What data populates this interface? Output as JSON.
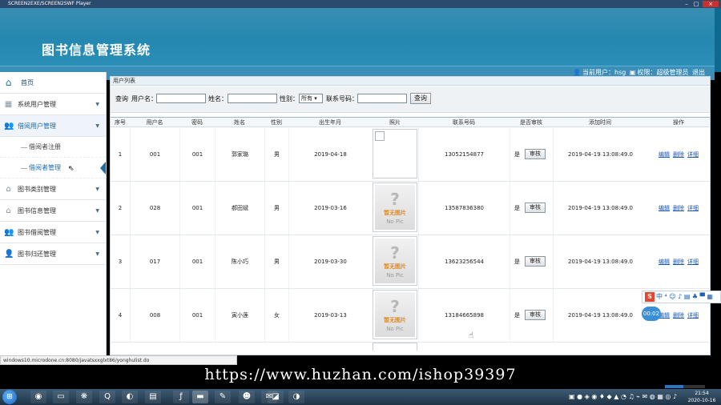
{
  "window": {
    "title": "SCREEN2EXE/SCREEN2SWF Player"
  },
  "header": {
    "system_title": "图书信息管理系统",
    "user_label": "当前用户：hsg",
    "role_label": "权限：超级管理员",
    "logout": "退出"
  },
  "sidebar": {
    "home": "首页",
    "items": [
      {
        "label": "系统用户管理"
      },
      {
        "label": "借阅用户管理"
      },
      {
        "label": "图书类别管理"
      },
      {
        "label": "图书信息管理"
      },
      {
        "label": "图书借阅管理"
      },
      {
        "label": "图书归还管理"
      }
    ],
    "subitems": [
      {
        "label": "借阅者注册"
      },
      {
        "label": "借阅者管理"
      }
    ]
  },
  "panel": {
    "title": "用户列表"
  },
  "search": {
    "prefix": "查询",
    "username_label": "用户名：",
    "name_label": "姓名：",
    "gender_label": "性别：",
    "gender_selected": "所有",
    "phone_label": "联系号码：",
    "query_button": "查询"
  },
  "table": {
    "headers": [
      "序号",
      "用户名",
      "密码",
      "姓名",
      "性别",
      "出生年月",
      "照片",
      "联系号码",
      "是否审核",
      "添加时间",
      "操作"
    ],
    "rows": [
      {
        "no": "1",
        "username": "001",
        "password": "001",
        "name": "郭家璐",
        "gender": "男",
        "birth": "2019-04-18",
        "photo": "broken",
        "phone": "13052154877",
        "audited": "是",
        "added": "2019-04-19 13:08:49.0"
      },
      {
        "no": "2",
        "username": "028",
        "password": "001",
        "name": "郝田斌",
        "gender": "男",
        "birth": "2019-03-16",
        "photo": "nopic",
        "phone": "13587836380",
        "audited": "是",
        "added": "2019-04-19 13:08:49.0"
      },
      {
        "no": "3",
        "username": "017",
        "password": "001",
        "name": "陈小巧",
        "gender": "男",
        "birth": "2019-03-30",
        "photo": "nopic",
        "phone": "13623256544",
        "audited": "是",
        "added": "2019-04-19 13:08:49.0"
      },
      {
        "no": "4",
        "username": "008",
        "password": "001",
        "name": "寅小莲",
        "gender": "女",
        "birth": "2019-03-13",
        "photo": "nopic",
        "phone": "13184665898",
        "audited": "是",
        "added": "2019-04-19 13:08:49.0"
      }
    ],
    "audit_button": "审核",
    "ops": {
      "edit": "编辑",
      "delete": "删除",
      "detail": "详细"
    },
    "nopic_text": "暂无图片",
    "nopic_sub": "No Pic"
  },
  "statusbar": {
    "url": "windows10.microdone.cn:8080/javatsxxglxt86/yonghulist.do"
  },
  "ime": {
    "logo": "S",
    "text": "中 ⁴ ☺ ♪ ▤ ♣ ▀ ▦"
  },
  "bubble": {
    "text": "00:02"
  },
  "watermark": {
    "text": "https://www.huzhan.com/ishop39397"
  },
  "player": {
    "progress": 0.45
  },
  "clock": {
    "time": "21:54",
    "date": "2020-10-16"
  },
  "colors": {
    "header": "#1d7fa8",
    "link": "#1a56b0",
    "accent": "#1d6da3"
  }
}
